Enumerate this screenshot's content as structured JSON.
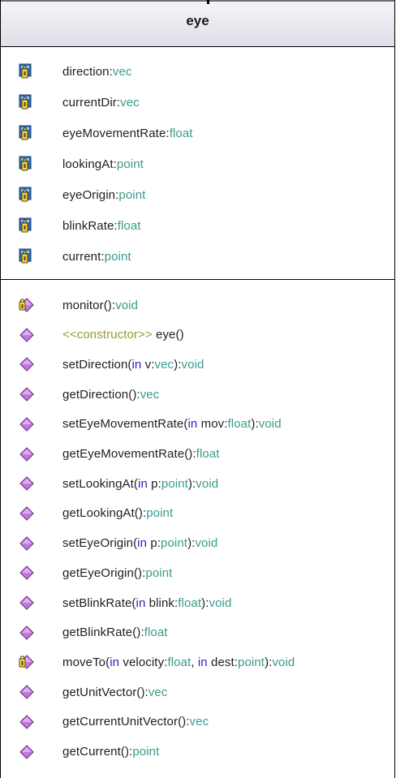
{
  "class": {
    "name": "eye",
    "attributes": [
      {
        "name": "direction",
        "sep": ":",
        "type": "vec"
      },
      {
        "name": "currentDir",
        "sep": ":",
        "type": "vec"
      },
      {
        "name": "eyeMovementRate",
        "sep": ":",
        "type": "float"
      },
      {
        "name": "lookingAt",
        "sep": ":",
        "type": "point"
      },
      {
        "name": "eyeOrigin",
        "sep": ":",
        "type": "point"
      },
      {
        "name": "blinkRate",
        "sep": ":",
        "type": "float"
      },
      {
        "name": "current",
        "sep": ":",
        "type": "point"
      }
    ],
    "operations": [
      {
        "visibility": "private",
        "parts": [
          {
            "t": "monitor():"
          },
          {
            "t": "void",
            "c": "type"
          }
        ]
      },
      {
        "visibility": "public",
        "parts": [
          {
            "t": "<<constructor>>",
            "c": "stereo"
          },
          {
            "t": " eye()"
          }
        ]
      },
      {
        "visibility": "public",
        "parts": [
          {
            "t": "setDirection("
          },
          {
            "t": "in",
            "c": "kw"
          },
          {
            "t": " v:"
          },
          {
            "t": "vec",
            "c": "type"
          },
          {
            "t": "):"
          },
          {
            "t": "void",
            "c": "type"
          }
        ]
      },
      {
        "visibility": "public",
        "parts": [
          {
            "t": "getDirection():"
          },
          {
            "t": "vec",
            "c": "type"
          }
        ]
      },
      {
        "visibility": "public",
        "parts": [
          {
            "t": "setEyeMovementRate("
          },
          {
            "t": "in",
            "c": "kw"
          },
          {
            "t": " mov:"
          },
          {
            "t": "float",
            "c": "type"
          },
          {
            "t": "):"
          },
          {
            "t": "void",
            "c": "type"
          }
        ]
      },
      {
        "visibility": "public",
        "parts": [
          {
            "t": "getEyeMovementRate():"
          },
          {
            "t": "float",
            "c": "type"
          }
        ]
      },
      {
        "visibility": "public",
        "parts": [
          {
            "t": "setLookingAt("
          },
          {
            "t": "in",
            "c": "kw"
          },
          {
            "t": " p:"
          },
          {
            "t": "point",
            "c": "type"
          },
          {
            "t": "):"
          },
          {
            "t": "void",
            "c": "type"
          }
        ]
      },
      {
        "visibility": "public",
        "parts": [
          {
            "t": "getLookingAt():"
          },
          {
            "t": "point",
            "c": "type"
          }
        ]
      },
      {
        "visibility": "public",
        "parts": [
          {
            "t": "setEyeOrigin("
          },
          {
            "t": "in",
            "c": "kw"
          },
          {
            "t": " p:"
          },
          {
            "t": "point",
            "c": "type"
          },
          {
            "t": "):"
          },
          {
            "t": "void",
            "c": "type"
          }
        ]
      },
      {
        "visibility": "public",
        "parts": [
          {
            "t": "getEyeOrigin():"
          },
          {
            "t": "point",
            "c": "type"
          }
        ]
      },
      {
        "visibility": "public",
        "parts": [
          {
            "t": "setBlinkRate("
          },
          {
            "t": "in",
            "c": "kw"
          },
          {
            "t": " blink:"
          },
          {
            "t": "float",
            "c": "type"
          },
          {
            "t": "):"
          },
          {
            "t": "void",
            "c": "type"
          }
        ]
      },
      {
        "visibility": "public",
        "parts": [
          {
            "t": "getBlinkRate():"
          },
          {
            "t": "float",
            "c": "type"
          }
        ]
      },
      {
        "visibility": "private",
        "parts": [
          {
            "t": "moveTo("
          },
          {
            "t": "in",
            "c": "kw"
          },
          {
            "t": " velocity:"
          },
          {
            "t": "float",
            "c": "type"
          },
          {
            "t": ", "
          },
          {
            "t": "in",
            "c": "kw"
          },
          {
            "t": " dest:"
          },
          {
            "t": "point",
            "c": "type"
          },
          {
            "t": "):"
          },
          {
            "t": "void",
            "c": "type"
          }
        ]
      },
      {
        "visibility": "public",
        "parts": [
          {
            "t": "getUnitVector():"
          },
          {
            "t": "vec",
            "c": "type"
          }
        ]
      },
      {
        "visibility": "public",
        "parts": [
          {
            "t": "getCurrentUnitVector():"
          },
          {
            "t": "vec",
            "c": "type"
          }
        ]
      },
      {
        "visibility": "public",
        "parts": [
          {
            "t": "getCurrent():"
          },
          {
            "t": "point",
            "c": "type"
          }
        ]
      }
    ]
  },
  "colors": {
    "type": "#3a9a8c",
    "keyword": "#2424c8",
    "stereotype": "#9c9a2c",
    "attribute_icon": "#2f6aa8",
    "operation_icon": "#c07ad8"
  },
  "icons": {
    "attribute": "private-attribute-lock-icon",
    "public_operation": "public-operation-diamond-icon",
    "private_operation": "private-operation-diamond-lock-icon"
  }
}
